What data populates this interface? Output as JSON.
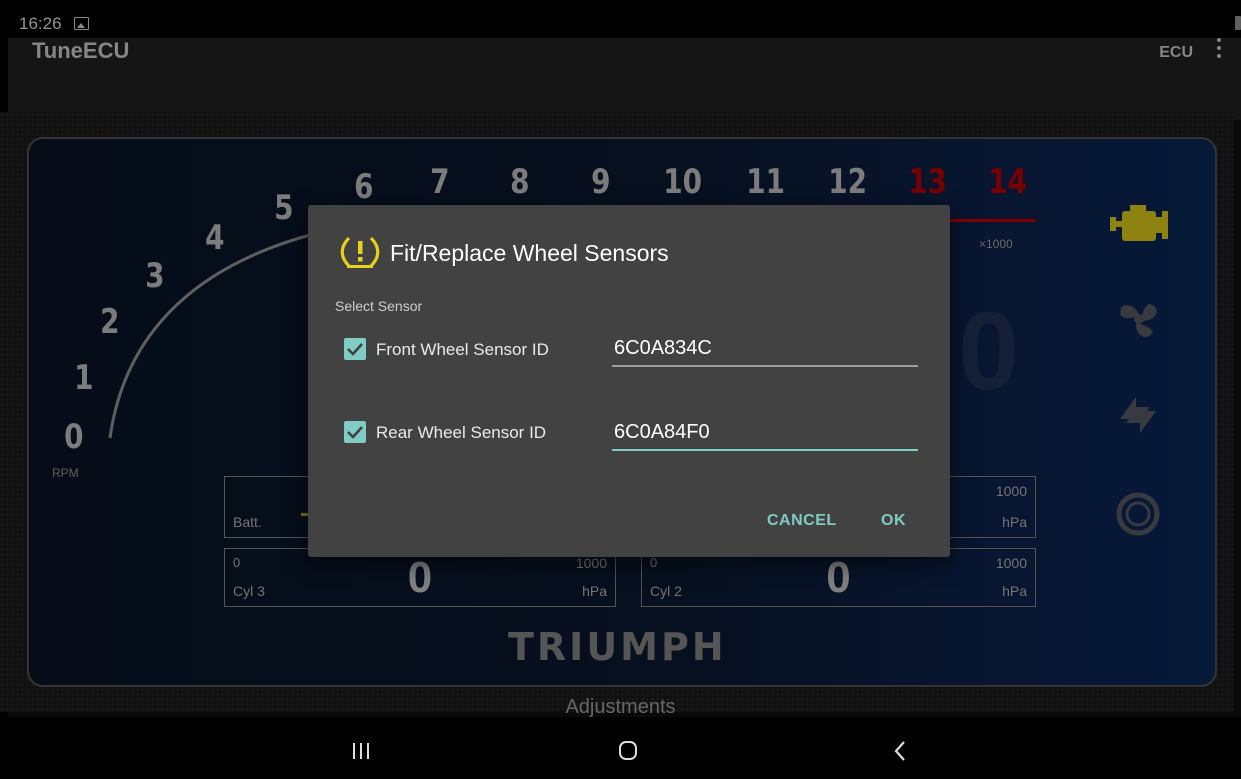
{
  "status": {
    "time": "16:26"
  },
  "appbar": {
    "title": "TuneECU",
    "ecu_label": "ECU"
  },
  "dashboard": {
    "rpm_ticks": [
      "0",
      "1",
      "2",
      "3",
      "4",
      "5",
      "6",
      "7",
      "8",
      "9",
      "10",
      "11",
      "12",
      "13",
      "14"
    ],
    "rpm_unit": "RPM",
    "multiplier": "×1000",
    "big_value": "0",
    "gauges": [
      {
        "label": "Batt.",
        "min": "",
        "max": "",
        "unit": "",
        "value": ""
      },
      {
        "label": "",
        "min": "",
        "max": "1000",
        "unit": "hPa",
        "value": ""
      },
      {
        "label": "Cyl 3",
        "min": "0",
        "max": "1000",
        "unit": "hPa",
        "value": "0"
      },
      {
        "label": "Cyl 2",
        "min": "0",
        "max": "1000",
        "unit": "hPa",
        "value": "0"
      }
    ],
    "brand": "TRIUMPH",
    "footer_label": "Adjustments",
    "colors": {
      "redline": "#c20000",
      "warning_icon": "#e6d21a"
    }
  },
  "dialog": {
    "title": "Fit/Replace Wheel Sensors",
    "section_label": "Select Sensor",
    "sensors": [
      {
        "label": "Front Wheel Sensor ID",
        "value": "6C0A834C",
        "checked": true
      },
      {
        "label": "Rear Wheel Sensor ID",
        "value": "6C0A84F0",
        "checked": true
      }
    ],
    "cancel_label": "CANCEL",
    "ok_label": "OK",
    "accent": "#80cbc4"
  },
  "navbar": {
    "icons": [
      "recent-apps-icon",
      "home-icon",
      "back-icon"
    ]
  }
}
